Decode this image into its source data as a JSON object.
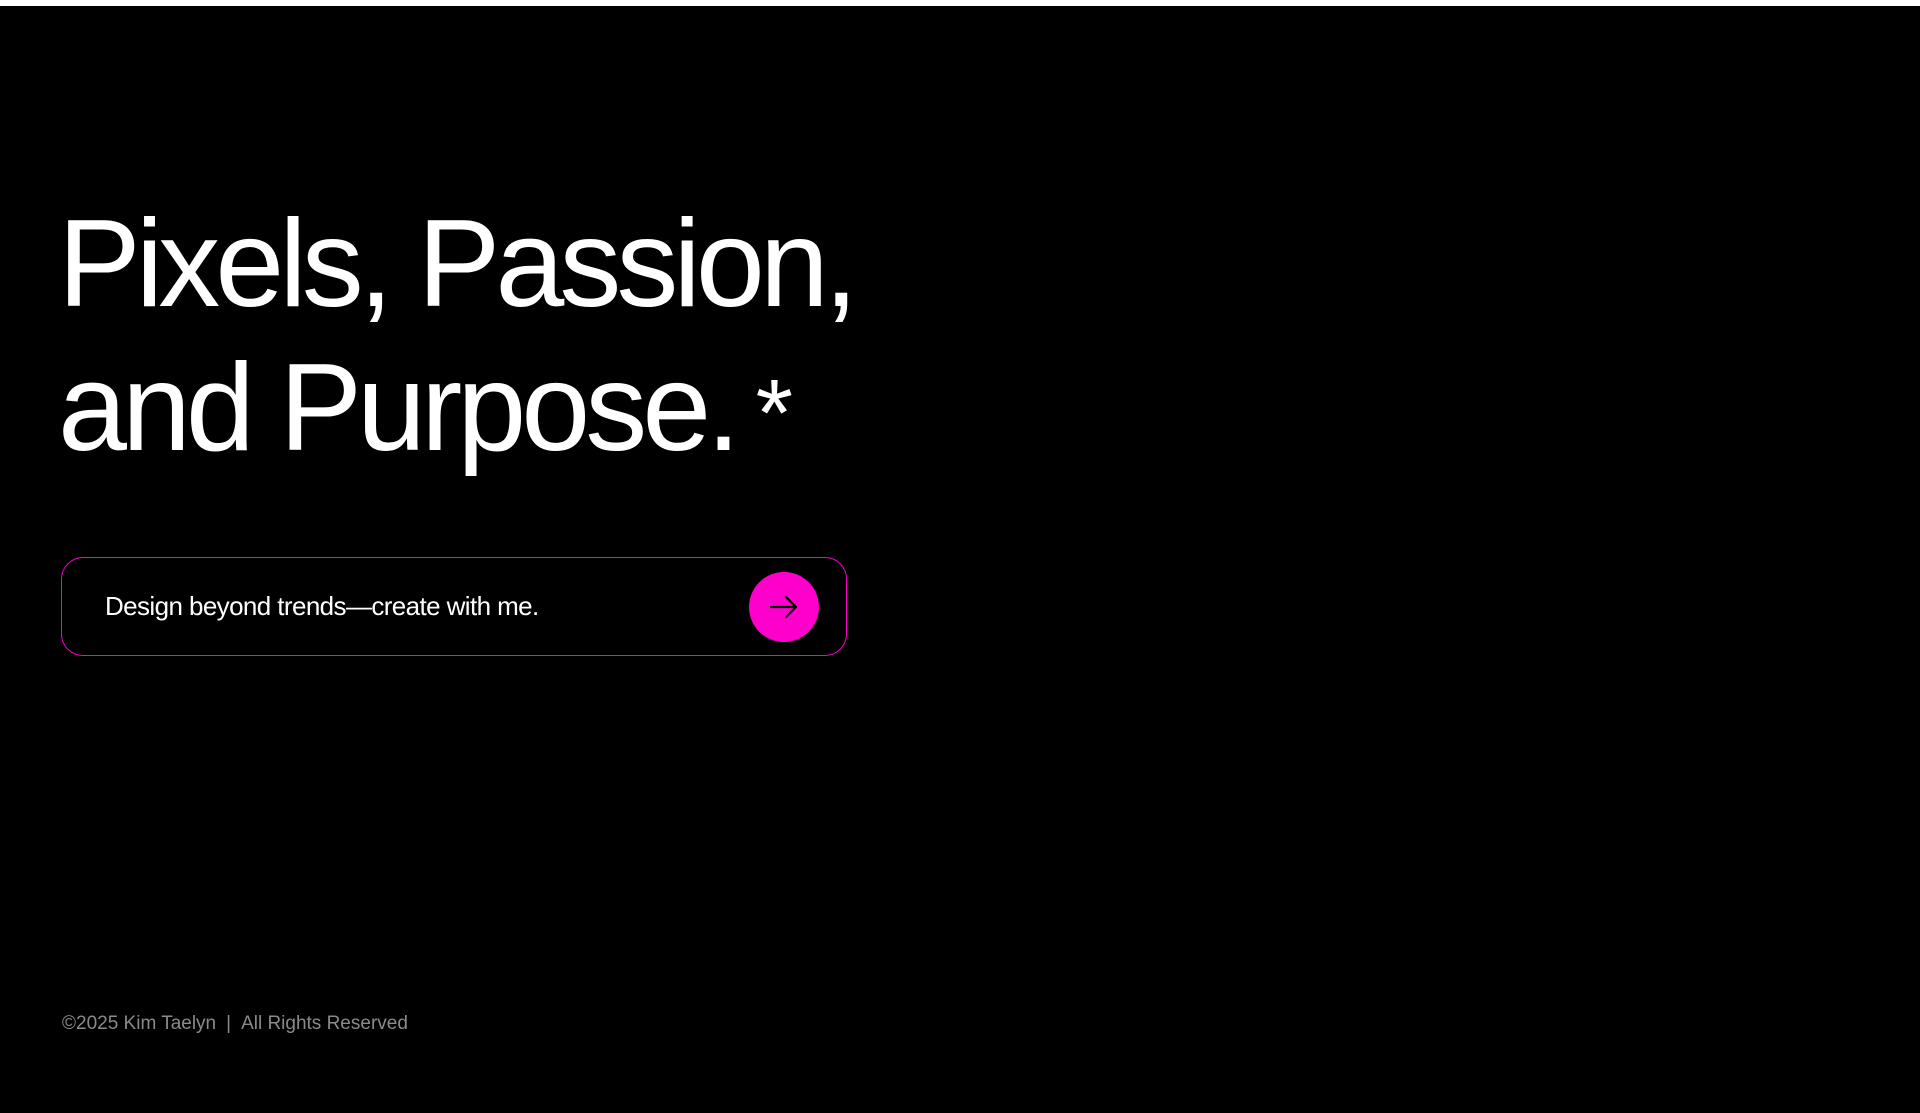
{
  "hero": {
    "line1": "Pixels, Passion,",
    "line2": "and Purpose.",
    "asterisk": "*"
  },
  "cta": {
    "text": "Design beyond trends—create with me.",
    "button_icon": "arrow-right-icon"
  },
  "footer": {
    "copyright": "©2025 Kim Taelyn",
    "separator": "|",
    "rights": "All Rights Reserved"
  },
  "colors": {
    "background": "#000000",
    "accent": "#ff00cc",
    "text": "#ffffff",
    "muted": "#8a8a8a"
  }
}
